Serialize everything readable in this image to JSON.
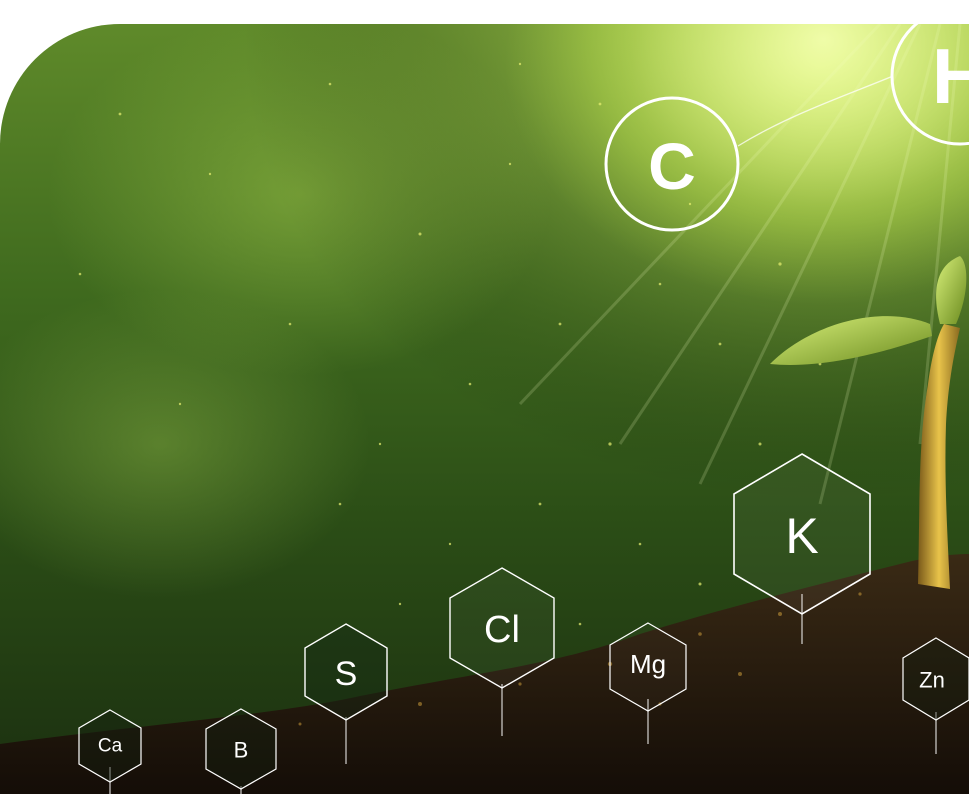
{
  "image": {
    "scene": "plant-seedling-in-soil",
    "colors": {
      "background_dark": "#1b2f10",
      "background_mid": "#3f6a1e",
      "glow": "#e6ff78",
      "outline": "#ffffff",
      "soil": "#2a1d10"
    },
    "elements": {
      "circle_c": "C",
      "circle_h": "H",
      "hex_k": "K",
      "hex_cl": "Cl",
      "hex_s": "S",
      "hex_mg": "Mg",
      "hex_zn": "Zn",
      "hex_ca": "Ca",
      "hex_b": "B"
    }
  }
}
